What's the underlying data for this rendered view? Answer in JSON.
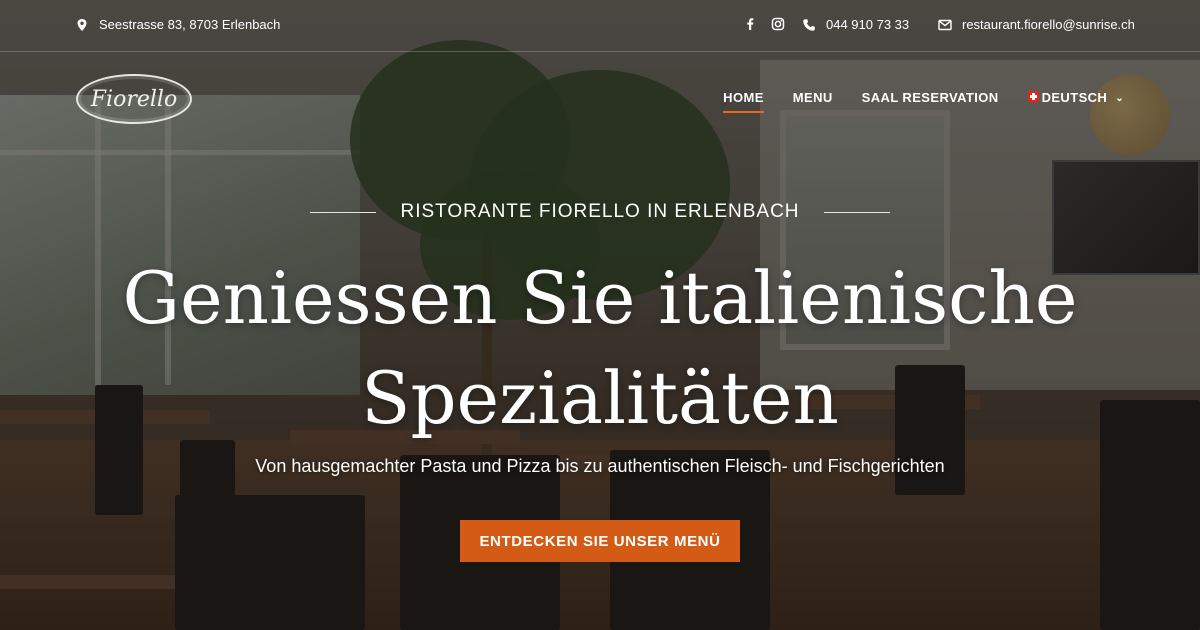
{
  "topbar": {
    "address": "Seestrasse 83, 8703 Erlenbach",
    "phone": "044 910 73 33",
    "email": "restaurant.fiorello@sunrise.ch",
    "icons": [
      "location-pin-icon",
      "facebook-icon",
      "instagram-icon",
      "phone-icon",
      "envelope-icon"
    ]
  },
  "logo": {
    "text": "Fiorello"
  },
  "nav": {
    "items": [
      {
        "label": "HOME",
        "active": true
      },
      {
        "label": "MENU",
        "active": false
      },
      {
        "label": "SAAL RESERVATION",
        "active": false
      }
    ],
    "language": {
      "label": "DEUTSCH",
      "flag": "swiss-flag-icon",
      "icon": "chevron-down-icon"
    }
  },
  "hero": {
    "eyebrow": "RISTORANTE FIORELLO IN ERLENBACH",
    "headline_line1": "Geniessen Sie italienische",
    "headline_line2": "Spezialitäten",
    "subline": "Von hausgemachter Pasta und Pizza bis zu authentischen Fleisch- und Fischgerichten",
    "cta_label": "ENTDECKEN SIE UNSER MENÜ"
  },
  "colors": {
    "accent": "#d45b15",
    "nav_underline": "#e8661f",
    "text": "#ffffff"
  }
}
